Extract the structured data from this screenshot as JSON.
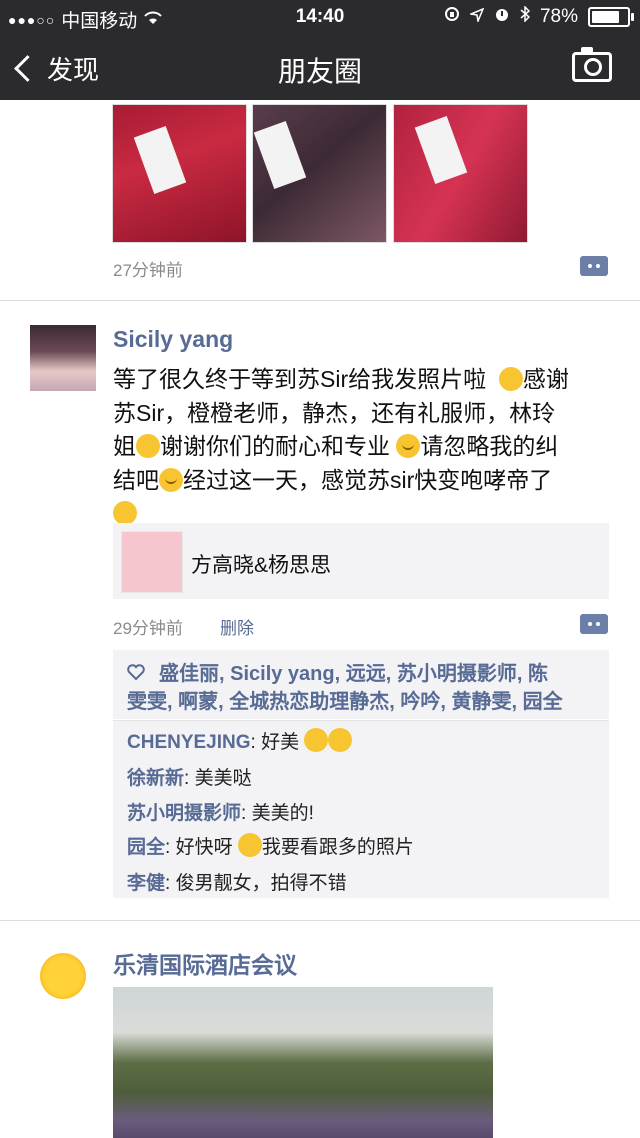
{
  "status_bar": {
    "signal": "●●●○○",
    "carrier": "中国移动",
    "time": "14:40",
    "battery": "78%",
    "battery_level": 0.78
  },
  "nav": {
    "back_label": "发现",
    "title": "朋友圈"
  },
  "post1": {
    "time": "27分钟前"
  },
  "post2": {
    "username": "Sicily yang",
    "text_line1": "等了很久终于等到苏Sir给我发照片啦",
    "text_line1b": "感谢",
    "text_line2": "苏Sir，橙橙老师，静杰，还有礼服师，林玲",
    "text_line3a": "姐",
    "text_line3b": "谢谢你们的耐心和专业",
    "text_line3c": "请忽略我的纠",
    "text_line4a": "结吧",
    "text_line4b": "经过这一天，感觉苏sir快变咆哮帝了",
    "link_title": "方高晓&杨思思",
    "time": "29分钟前",
    "delete_label": "删除",
    "likes_line1": "盛佳丽, Sicily yang, 远远, 苏小明摄影师, 陈",
    "likes_line2": "雯雯, 啊蒙, 全城热恋助理静杰, 吟吟, 黄静雯, 园全",
    "comments": [
      {
        "name": "CHENYEJING",
        "text": ": 好美"
      },
      {
        "name": "徐新新",
        "text": ": 美美哒"
      },
      {
        "name": "苏小明摄影师",
        "text": ": 美美的!"
      },
      {
        "name": "园全",
        "text": ": 好快呀",
        "text2": "我要看跟多的照片"
      },
      {
        "name": "李健",
        "text": ": 俊男靓女，拍得不错"
      }
    ]
  },
  "post3": {
    "username": "乐清国际酒店会议"
  },
  "colors": {
    "nav_bg": "#2b2b2e",
    "link_blue": "#576b95",
    "panel_bg": "#f3f3f5"
  }
}
